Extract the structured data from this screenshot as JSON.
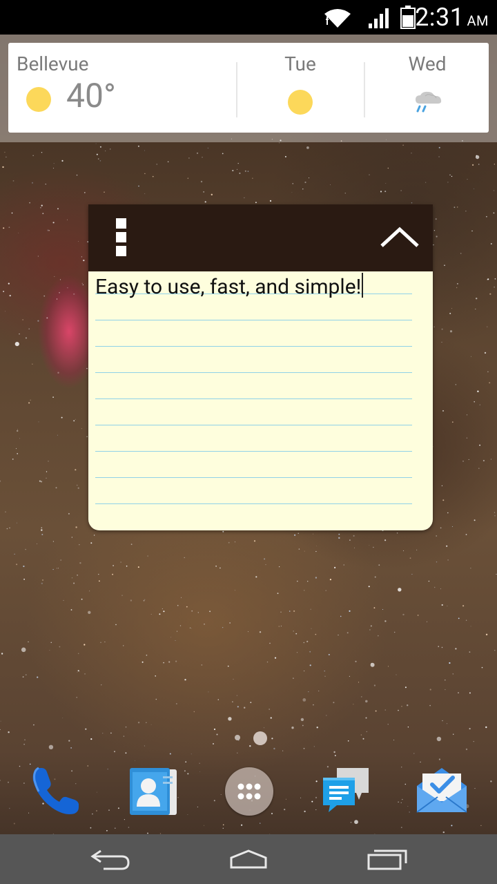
{
  "status_bar": {
    "time": "2:31",
    "ampm": "AM",
    "icons": [
      "wifi-icon",
      "signal-icon",
      "battery-icon"
    ]
  },
  "weather": {
    "city": "Bellevue",
    "current_temp": "40°",
    "current_icon": "sun-icon",
    "forecast": [
      {
        "day": "Tue",
        "icon": "sun-icon"
      },
      {
        "day": "Wed",
        "icon": "rain-cloud-icon"
      }
    ]
  },
  "note": {
    "text": "Easy to use, fast, and simple!",
    "menu_icon": "menu-icon",
    "collapse_icon": "chevron-up-icon",
    "line_count": 9
  },
  "pager": {
    "pages": 2,
    "current": 2
  },
  "dock": {
    "apps": [
      "phone-icon",
      "contacts-icon",
      "app-drawer-icon",
      "messaging-icon",
      "inbox-icon"
    ]
  },
  "nav_bar": {
    "buttons": [
      "back-icon",
      "home-icon",
      "recents-icon"
    ]
  },
  "colors": {
    "note_header": "#2a1a12",
    "note_paper": "#fefedd",
    "note_rule": "#8fd1e8",
    "sun": "#fcd85a",
    "nav_bar": "#565656"
  }
}
